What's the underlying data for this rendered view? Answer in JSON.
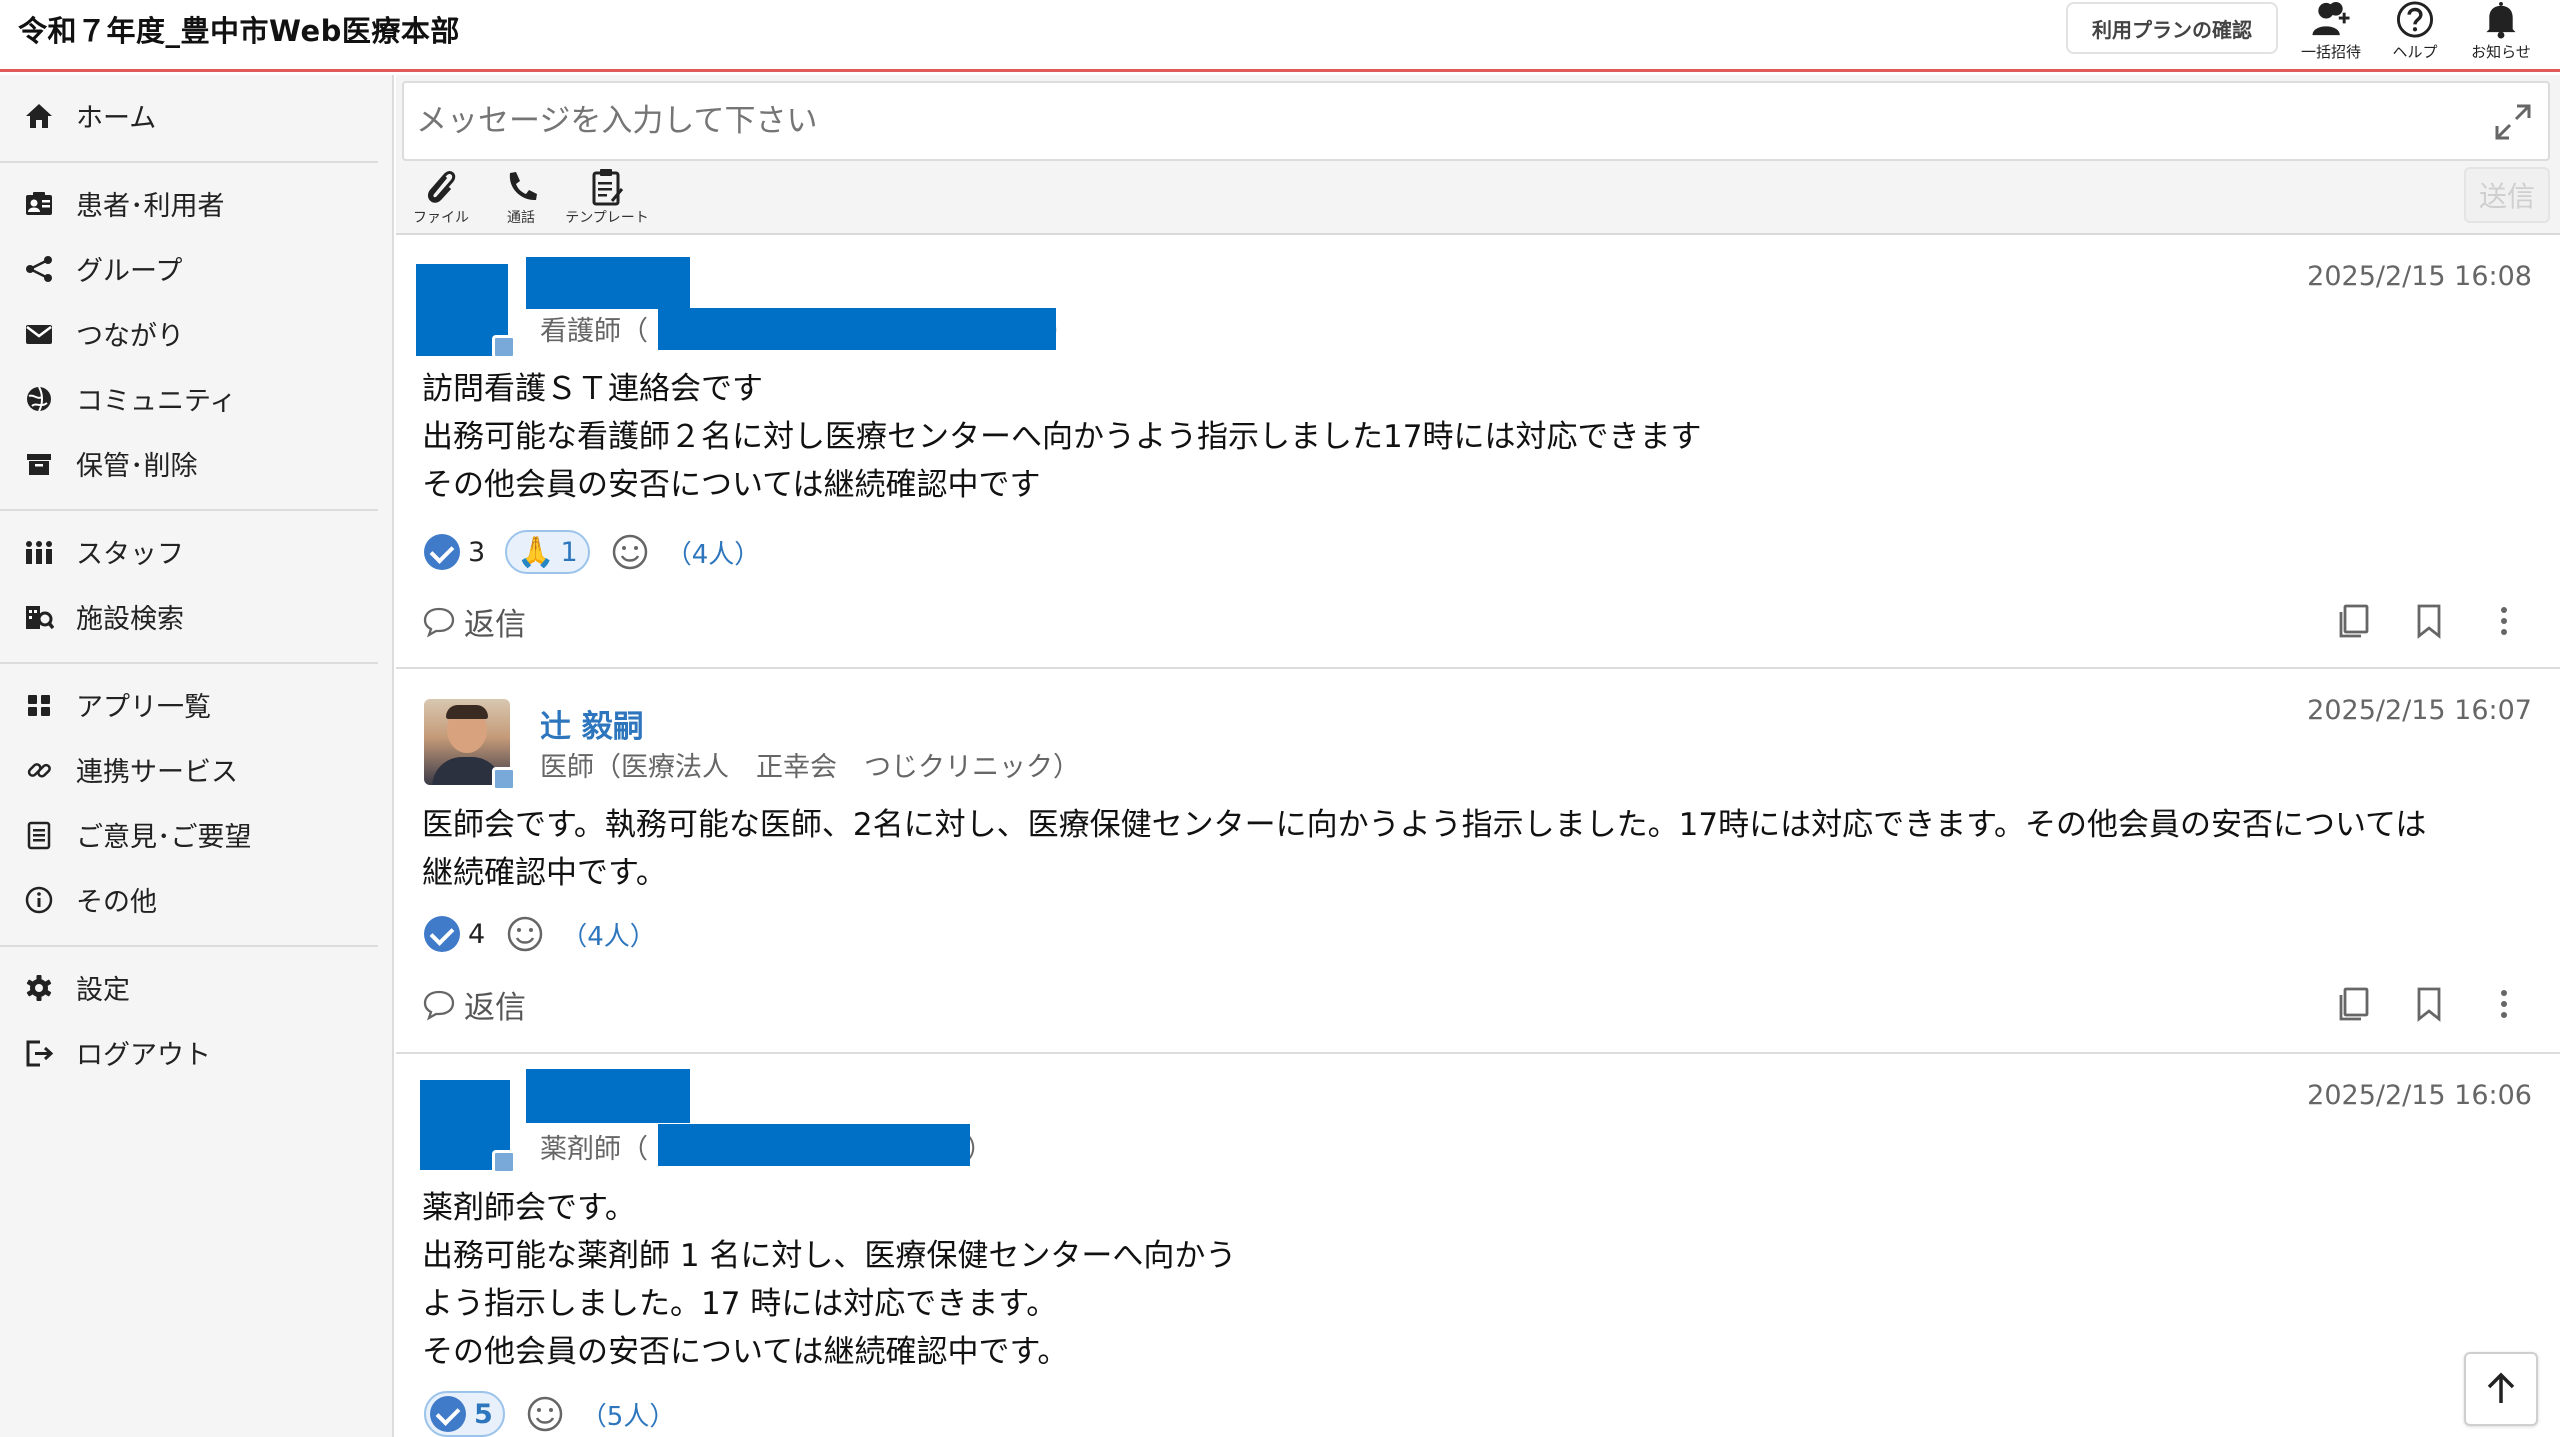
{
  "header": {
    "title": "令和７年度_豊中市Web医療本部",
    "plan_button": "利用プランの確認",
    "invite_label": "一括招待",
    "help_label": "ヘルプ",
    "notify_label": "お知らせ",
    "accent_color": "#e05a5a"
  },
  "sidebar": {
    "items": [
      {
        "label": "ホーム",
        "icon": "home-icon"
      },
      {
        "label": "患者･利用者",
        "icon": "patient-card-icon"
      },
      {
        "label": "グループ",
        "icon": "share-icon"
      },
      {
        "label": "つながり",
        "icon": "envelope-icon"
      },
      {
        "label": "コミュニティ",
        "icon": "globe-icon"
      },
      {
        "label": "保管･削除",
        "icon": "archive-icon"
      },
      {
        "label": "スタッフ",
        "icon": "staff-icon"
      },
      {
        "label": "施設検索",
        "icon": "facility-search-icon"
      },
      {
        "label": "アプリ一覧",
        "icon": "grid-icon"
      },
      {
        "label": "連携サービス",
        "icon": "link-icon"
      },
      {
        "label": "ご意見･ご要望",
        "icon": "document-icon"
      },
      {
        "label": "その他",
        "icon": "info-icon"
      },
      {
        "label": "設定",
        "icon": "gear-icon"
      },
      {
        "label": "ログアウト",
        "icon": "logout-icon"
      }
    ]
  },
  "composer": {
    "placeholder": "メッセージを入力して下さい",
    "file_label": "ファイル",
    "call_label": "通話",
    "template_label": "テンプレート",
    "send_label": "送信"
  },
  "posts": [
    {
      "role_prefix": "看護師（",
      "role_suffix": "）",
      "time": "2025/2/15 16:08",
      "body": "訪問看護ＳＴ連絡会です\n出務可能な看護師２名に対し医療センターへ向かうよう指示しました17時には対応できます\nその他会員の安否については継続確認中です",
      "check_count": "3",
      "pray_emoji": "🙏",
      "pray_count": "1",
      "people": "（4人）",
      "reply_label": "返信"
    },
    {
      "author": "辻 毅嗣",
      "role": "医師（医療法人　正幸会　つじクリニック）",
      "time": "2025/2/15 16:07",
      "body": "医師会です。執務可能な医師、2名に対し、医療保健センターに向かうよう指示しました。17時には対応できます。その他会員の安否については\n継続確認中です。",
      "check_count": "4",
      "people": "（4人）",
      "reply_label": "返信"
    },
    {
      "role_prefix": "薬剤師（",
      "role_suffix": "）",
      "time": "2025/2/15 16:06",
      "body": "薬剤師会です。\n出務可能な薬剤師 1 名に対し、医療保健センターへ向かう\nよう指示しました。17 時には対応できます。\nその他会員の安否については継続確認中です。",
      "check_count": "5",
      "people": "（5人）"
    }
  ],
  "colors": {
    "redaction": "#0070c6",
    "link_blue": "#2d76bd",
    "check_blue": "#3f7bc9"
  }
}
